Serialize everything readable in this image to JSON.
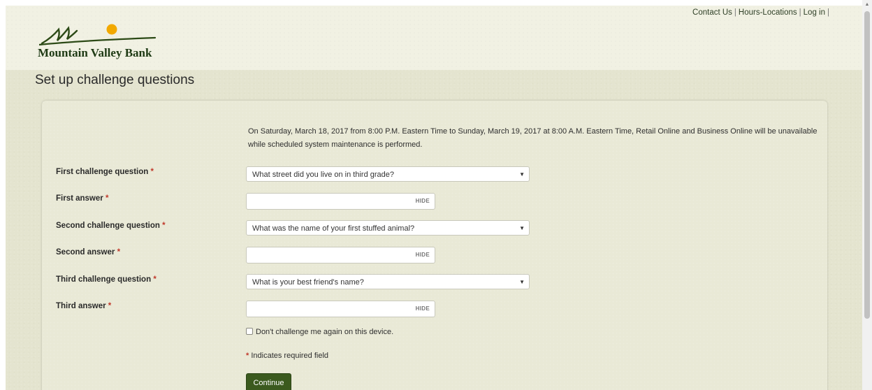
{
  "header": {
    "logo_text": "Mountain Valley Bank",
    "links": [
      "Contact Us",
      "Hours-Locations",
      "Log in"
    ],
    "link_separator": "|"
  },
  "page": {
    "title": "Set up challenge questions"
  },
  "form": {
    "notice": "On Saturday, March 18, 2017 from 8:00 P.M. Eastern Time to Sunday, March 19, 2017 at 8:00 A.M. Eastern Time, Retail Online and Business Online will be unavailable while scheduled system maintenance is performed.",
    "required_marker": "*",
    "rows": [
      {
        "label": "First challenge question",
        "type": "select",
        "value": "What street did you live on in third grade?"
      },
      {
        "label": "First answer",
        "type": "answer",
        "value": "",
        "toggle": "HIDE"
      },
      {
        "label": "Second challenge question",
        "type": "select",
        "value": "What was the name of your first stuffed animal?"
      },
      {
        "label": "Second answer",
        "type": "answer",
        "value": "",
        "toggle": "HIDE"
      },
      {
        "label": "Third challenge question",
        "type": "select",
        "value": "What is your best friend's name?"
      },
      {
        "label": "Third answer",
        "type": "answer",
        "value": "",
        "toggle": "HIDE"
      }
    ],
    "remember_label": "Don't challenge me again on this device.",
    "required_note": "Indicates required field",
    "continue_label": "Continue"
  },
  "icons": {
    "dropdown": "chevron-down-icon",
    "scroll_up": "arrow-up-icon"
  },
  "colors": {
    "brand_green": "#3b5a1e",
    "logo_sun": "#f2a900",
    "required_red": "#c0392b",
    "background": "#e4e4cf"
  }
}
